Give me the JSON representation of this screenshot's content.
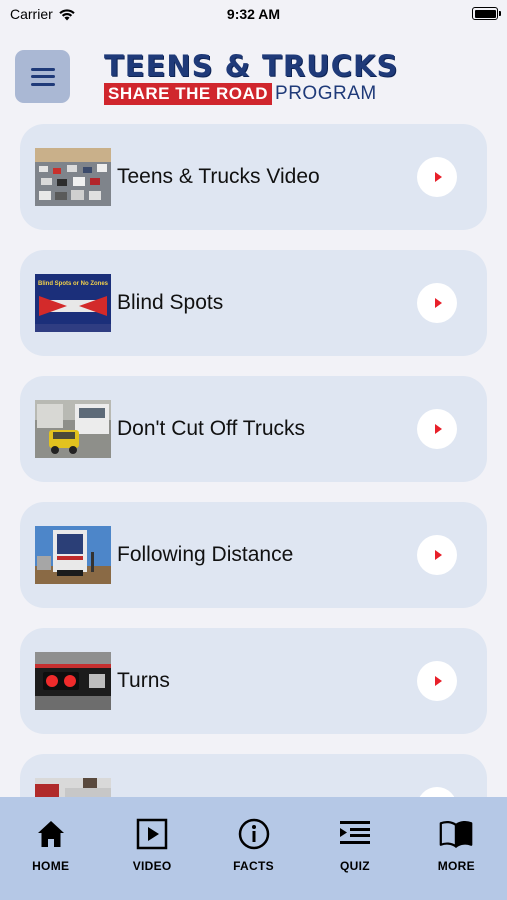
{
  "status_bar": {
    "carrier": "Carrier",
    "time": "9:32 AM"
  },
  "header": {
    "logo_line1": "TEENS & TRUCKS",
    "logo_tag": "SHARE THE ROAD",
    "logo_program": "PROGRAM"
  },
  "videos": [
    {
      "title": "Teens & Trucks Video"
    },
    {
      "title": "Blind Spots",
      "thumb_text": "Blind Spots or No Zones"
    },
    {
      "title": "Don't Cut Off Trucks"
    },
    {
      "title": "Following Distance"
    },
    {
      "title": "Turns"
    },
    {
      "title": ""
    }
  ],
  "tabbar": {
    "home": "HOME",
    "video": "VIDEO",
    "facts": "FACTS",
    "quiz": "QUIZ",
    "more": "MORE"
  },
  "colors": {
    "accent": "#1f3a79",
    "brand_red": "#d0262d",
    "card_bg": "#dfe6f2",
    "tabbar_bg": "#b5c8e6",
    "menu_button_bg": "#aab8d4"
  }
}
